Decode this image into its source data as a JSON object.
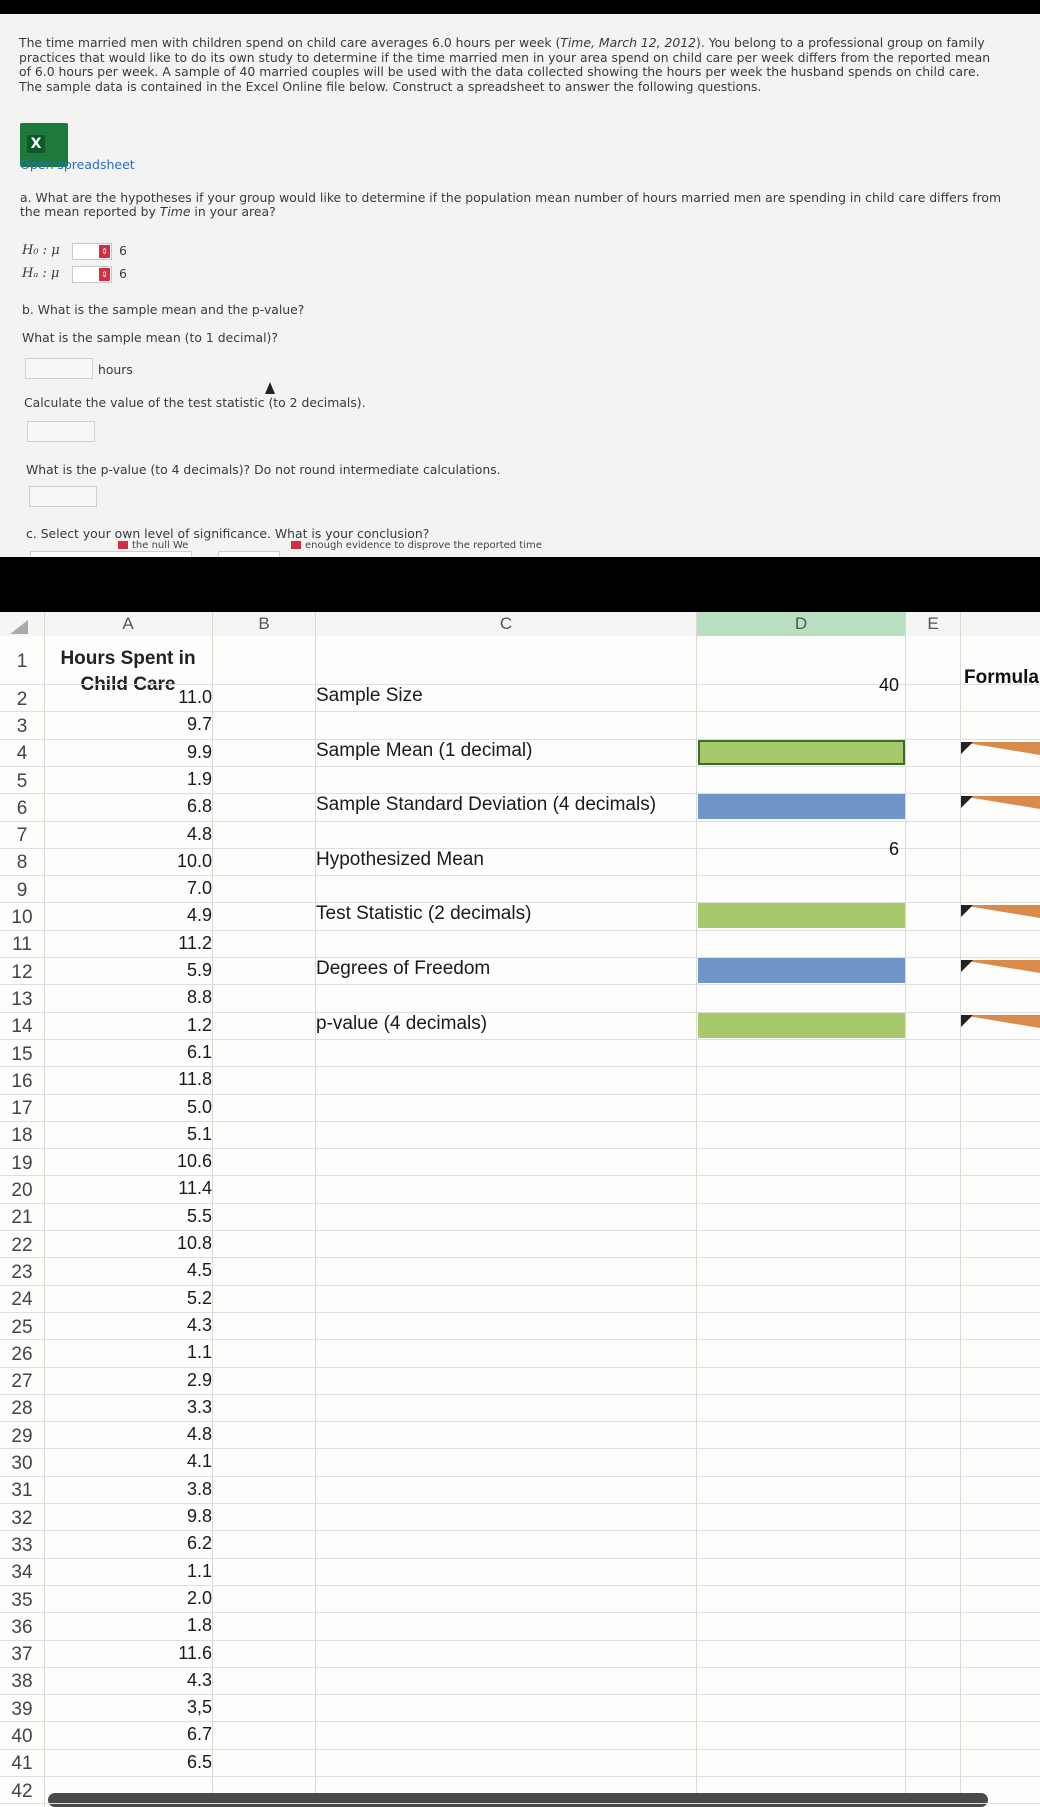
{
  "question": {
    "intro": [
      {
        "t": "The time married men with children spend on child care averages 6.0 hours per week ("
      },
      {
        "t": "Time, March 12, 2012",
        "i": true
      },
      {
        "t": "). You belong to a professional group on family practices that would like to do its own study to determine if the time married men in your area spend on child care per week differs from the reported mean of 6.0 hours per week. A sample of 40 married couples will be used with the data collected showing the hours per week the husband spends on child care. The sample data is contained in the Excel Online file below. Construct a spreadsheet to answer the following questions."
      }
    ],
    "excel_icon_letter": "X",
    "open_spreadsheet": "Open spreadsheet",
    "part_a": [
      {
        "t": "a. What are the hypotheses if your group would like to determine if the population mean number of hours married men are spending in child care differs from the mean reported by "
      },
      {
        "t": "Time",
        "i": true
      },
      {
        "t": " in your area?"
      }
    ],
    "h0_label": "H₀ : μ",
    "ha_label": "Hₐ : μ",
    "h0_value": "6",
    "ha_value": "6",
    "part_b": "b. What is the sample mean and the p-value?",
    "mean_q": "What is the sample mean (to 1 decimal)?",
    "hours_unit": "hours",
    "test_stat_q": "Calculate the value of the test statistic (to 2 decimals).",
    "pvalue_q": "What is the p-value (to 4 decimals)? Do not round intermediate calculations.",
    "part_c": "c. Select your own level of significance. What is your conclusion?",
    "cut_left": "the null We",
    "cut_right": "enough evidence to disprove the reported time"
  },
  "sheet": {
    "columns": [
      "A",
      "B",
      "C",
      "D",
      "E"
    ],
    "a1": [
      "Hours Spent in",
      "Child Care"
    ],
    "e1": "Formula",
    "row_numbers": [
      "1",
      "2",
      "3",
      "4",
      "5",
      "6",
      "7",
      "8",
      "9",
      "10",
      "11",
      "12",
      "13",
      "14",
      "15",
      "16",
      "17",
      "18",
      "19",
      "20",
      "21",
      "22",
      "23",
      "24",
      "25",
      "26",
      "27",
      "28",
      "29",
      "30",
      "31",
      "32",
      "33",
      "34",
      "35",
      "36",
      "37",
      "38",
      "39",
      "40",
      "41",
      "42"
    ],
    "hours": [
      "11.0",
      "9.7",
      "9.9",
      "1.9",
      "6.8",
      "4.8",
      "10.0",
      "7.0",
      "4.9",
      "11.2",
      "5.9",
      "8.8",
      "1.2",
      "6.1",
      "11.8",
      "5.0",
      "5.1",
      "10.6",
      "11.4",
      "5.5",
      "10.8",
      "4.5",
      "5.2",
      "4.3",
      "1.1",
      "2.9",
      "3.3",
      "4.8",
      "4.1",
      "3.8",
      "9.8",
      "6.2",
      "1.1",
      "2.0",
      "1.8",
      "11.6",
      "4.3",
      "3,5",
      "6.7",
      "6.5"
    ],
    "labels": [
      {
        "text": "Sample Size",
        "value": "40",
        "fill": "",
        "formula": false
      },
      {
        "text": "Sample Mean (1 decimal)",
        "value": "",
        "fill": "#a8c86c",
        "formula": true
      },
      {
        "text": "Sample Standard Deviation (4 decimals)",
        "value": "",
        "fill": "#6f95c8",
        "formula": true
      },
      {
        "text": "Hypothesized Mean",
        "value": "6",
        "fill": "",
        "formula": false
      },
      {
        "text": "Test Statistic (2 decimals)",
        "value": "",
        "fill": "#a8c86c",
        "formula": true
      },
      {
        "text": "Degrees of Freedom",
        "value": "",
        "fill": "#6f95c8",
        "formula": true
      },
      {
        "text": "p-value (4 decimals)",
        "value": "",
        "fill": "#a8c86c",
        "formula": true
      }
    ],
    "colors": {
      "green_input": "#a8c86c",
      "blue_input": "#6f95c8",
      "formula_marker": "#d98a4d"
    }
  }
}
